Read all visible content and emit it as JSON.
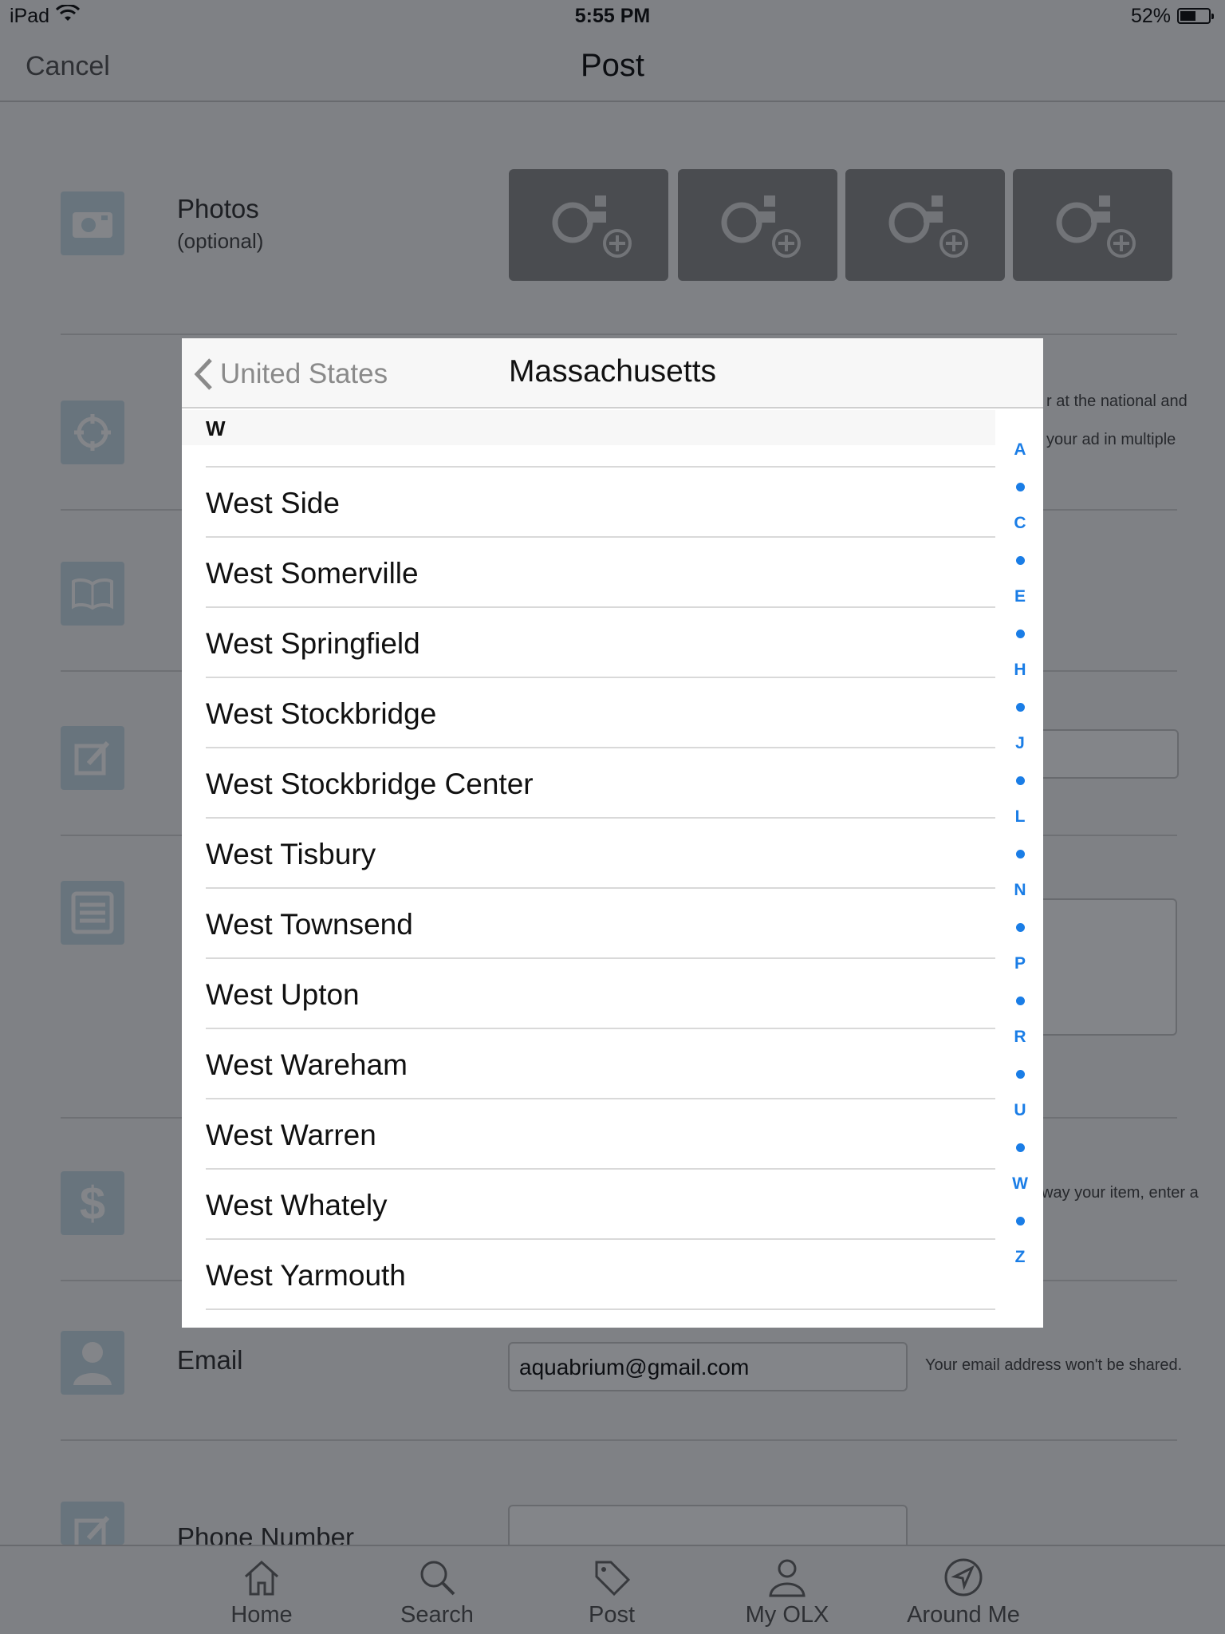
{
  "status_bar": {
    "carrier": "iPad",
    "time": "5:55 PM",
    "battery": "52%"
  },
  "nav": {
    "cancel": "Cancel",
    "title": "Post"
  },
  "photos": {
    "label": "Photos",
    "sub": "(optional)"
  },
  "side_notes": {
    "national": "r at the national and",
    "multiple": "your ad in multiple",
    "price": "way your item, enter a"
  },
  "email": {
    "label": "Email",
    "value": "aquabrium@gmail.com",
    "hint": "Your email address won't be shared."
  },
  "phone": {
    "label": "Phone Number"
  },
  "tabbar": [
    {
      "label": "Home",
      "icon": "home-icon"
    },
    {
      "label": "Search",
      "icon": "search-icon"
    },
    {
      "label": "Post",
      "icon": "tag-icon"
    },
    {
      "label": "My OLX",
      "icon": "person-icon"
    },
    {
      "label": "Around Me",
      "icon": "location-arrow-icon"
    }
  ],
  "popover": {
    "back_label": "United States",
    "title": "Massachusetts",
    "section": "W",
    "cities": [
      "West Side",
      "West Somerville",
      "West Springfield",
      "West Stockbridge",
      "West Stockbridge Center",
      "West Tisbury",
      "West Townsend",
      "West Upton",
      "West Wareham",
      "West Warren",
      "West Whately",
      "West Yarmouth"
    ],
    "index": [
      "A",
      "C",
      "E",
      "H",
      "J",
      "L",
      "N",
      "P",
      "R",
      "U",
      "W",
      "Z"
    ]
  },
  "colors": {
    "accent": "#1a7de6",
    "overlay": "rgba(8,12,20,0.50)"
  }
}
